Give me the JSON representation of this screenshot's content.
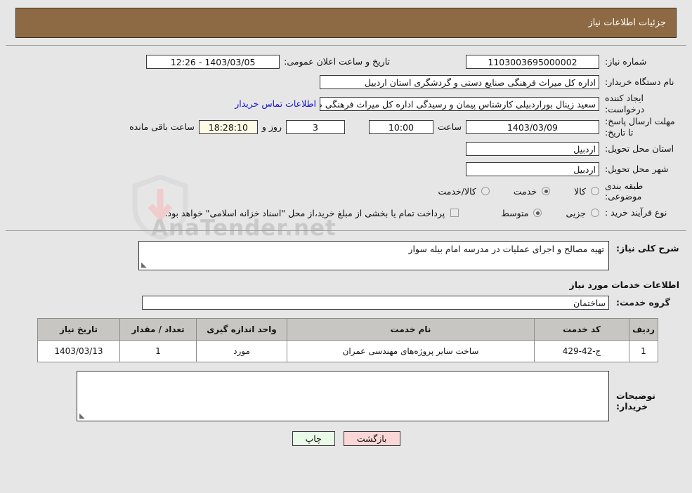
{
  "header": {
    "title": "جزئیات اطلاعات نیاز"
  },
  "watermark": {
    "text": "AnaTender.net",
    "shield_icon": "shield-icon"
  },
  "top_form": {
    "need_number": {
      "label": "شماره نیاز:",
      "value": "1103003695000002"
    },
    "announcement": {
      "label": "تاریخ و ساعت اعلان عمومی:",
      "value": "1403/03/05 - 12:26"
    },
    "buyer_org": {
      "label": "نام دستگاه خریدار:",
      "value": "اداره کل میراث فرهنگی  صنایع دستی و گردشگری استان اردبیل"
    },
    "requester": {
      "label": "ایجاد کننده درخواست:",
      "value": "سعید زینال بوراردبیلی کارشناس پیمان و رسیدگی اداره کل میراث فرهنگی  صنای",
      "contact_link": "اطلاعات تماس خریدار"
    },
    "deadline": {
      "label": "مهلت ارسال پاسخ: تا تاریخ:",
      "date_value": "1403/03/09",
      "hour_label": "ساعت",
      "hour_value": "10:00",
      "days_value": "3",
      "days_label": "روز و",
      "countdown_value": "18:28:10",
      "remaining_label": "ساعت باقی مانده"
    },
    "province": {
      "label": "استان محل تحویل:",
      "value": "اردبیل"
    },
    "city": {
      "label": "شهر محل تحویل:",
      "value": "اردبیل"
    },
    "classification": {
      "label": "طبقه بندی موضوعی:",
      "options": [
        {
          "label": "کالا",
          "selected": false
        },
        {
          "label": "خدمت",
          "selected": true
        },
        {
          "label": "کالا/خدمت",
          "selected": false
        }
      ]
    },
    "purchase_type": {
      "label": "نوع فرآیند خرید :",
      "options": [
        {
          "label": "جزیی",
          "selected": false
        },
        {
          "label": "متوسط",
          "selected": true
        }
      ],
      "checkbox_checked": false,
      "checkbox_text": "پرداخت تمام یا بخشی از مبلغ خرید،از محل \"اسناد خزانه اسلامی\" خواهد بود."
    }
  },
  "general_description": {
    "label": "شرح کلی نیاز:",
    "value": "تهیه مصالح و اجرای عملیات در مدرسه امام بیله سوار"
  },
  "services_section": {
    "title": "اطلاعات خدمات مورد نیاز",
    "group_label": "گروه خدمت:",
    "group_value": "ساختمان"
  },
  "table": {
    "headers": [
      "ردیف",
      "کد خدمت",
      "نام خدمت",
      "واحد اندازه گیری",
      "تعداد / مقدار",
      "تاریخ نیاز"
    ],
    "rows": [
      {
        "radif": "1",
        "code": "ج-42-429",
        "name": "ساخت سایر پروژه‌های مهندسی عمران",
        "unit": "مورد",
        "qty": "1",
        "date": "1403/03/13"
      }
    ]
  },
  "buyer_notes": {
    "label": "توضیحات خریدار:",
    "value": ""
  },
  "footer": {
    "print_label": "چاپ",
    "back_label": "بازگشت"
  },
  "colors": {
    "header_bg": "#8d6a43",
    "page_bg": "#e6e6e6",
    "link": "#1414d2",
    "table_header_bg": "#c8c6c3",
    "print_btn_bg": "#eafae8",
    "back_btn_bg": "#fbd6d6",
    "countdown_bg": "#fbfbe6"
  }
}
